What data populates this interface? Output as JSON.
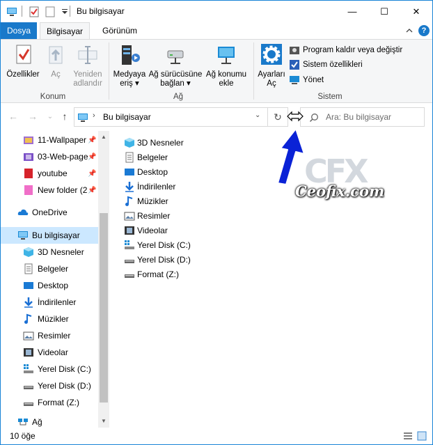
{
  "window": {
    "title": "Bu bilgisayar",
    "minimize_glyph": "—",
    "maximize_glyph": "☐",
    "close_glyph": "✕"
  },
  "ribbon_tabs": {
    "file": "Dosya",
    "computer": "Bilgisayar",
    "view": "Görünüm"
  },
  "ribbon": {
    "groups": {
      "location": "Konum",
      "network": "Ağ",
      "system": "Sistem"
    },
    "properties": "Özellikler",
    "open": "Aç",
    "rename_1": "Yeniden",
    "rename_2": "adlandır",
    "media_1": "Medyaya",
    "media_2": "eriş",
    "map_drive_1": "Ağ sürücüsüne",
    "map_drive_2": "bağlan",
    "add_location_1": "Ağ konumu",
    "add_location_2": "ekle",
    "settings_1": "Ayarları",
    "settings_2": "Aç",
    "uninstall": "Program kaldır veya değiştir",
    "system_props": "Sistem özellikleri",
    "manage": "Yönet"
  },
  "address": {
    "path": "Bu bilgisayar",
    "search_placeholder": "Ara: Bu bilgisayar"
  },
  "nav_pane": {
    "quick_access": [
      {
        "label": "11-Wallpaper"
      },
      {
        "label": "03-Web-page"
      },
      {
        "label": "youtube"
      },
      {
        "label": "New folder (2"
      }
    ],
    "onedrive": "OneDrive",
    "this_pc": "Bu bilgisayar",
    "pc_items": [
      {
        "label": "3D Nesneler"
      },
      {
        "label": "Belgeler"
      },
      {
        "label": "Desktop"
      },
      {
        "label": "İndirilenler"
      },
      {
        "label": "Müzikler"
      },
      {
        "label": "Resimler"
      },
      {
        "label": "Videolar"
      },
      {
        "label": "Yerel Disk (C:)"
      },
      {
        "label": "Yerel Disk (D:)"
      },
      {
        "label": "Format (Z:)"
      }
    ],
    "network": "Ağ"
  },
  "content": {
    "items": [
      {
        "label": "3D Nesneler"
      },
      {
        "label": "Belgeler"
      },
      {
        "label": "Desktop"
      },
      {
        "label": "İndirilenler"
      },
      {
        "label": "Müzikler"
      },
      {
        "label": "Resimler"
      },
      {
        "label": "Videolar"
      },
      {
        "label": "Yerel Disk (C:)"
      },
      {
        "label": "Yerel Disk (D:)"
      },
      {
        "label": "Format (Z:)"
      }
    ]
  },
  "status": {
    "count": "10 öğe"
  },
  "watermark": {
    "logo": "CFX",
    "text": "Ceofix.com"
  },
  "colors": {
    "accent": "#1979ca",
    "selection": "#cce8ff",
    "ribbon_bg": "#f5f6f7",
    "arrow": "#0a22d6"
  }
}
